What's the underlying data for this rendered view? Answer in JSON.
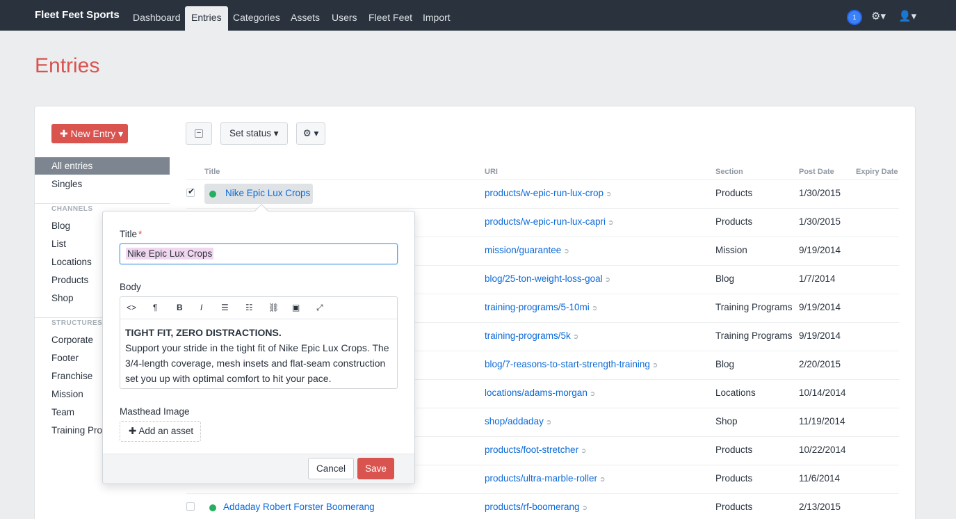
{
  "nav": {
    "brand": "Fleet Feet Sports",
    "items": [
      "Dashboard",
      "Entries",
      "Categories",
      "Assets",
      "Users",
      "Fleet Feet",
      "Import"
    ],
    "notification_count": "1"
  },
  "page": {
    "title": "Entries"
  },
  "sidebar": {
    "new_entry": "New Entry",
    "all_entries": "All entries",
    "singles": "Singles",
    "channels_heading": "CHANNELS",
    "channels": [
      "Blog",
      "List",
      "Locations",
      "Products",
      "Shop"
    ],
    "structures_heading": "STRUCTURES",
    "structures": [
      "Corporate",
      "Footer",
      "Franchise",
      "Mission",
      "Team",
      "Training Prog"
    ]
  },
  "toolbar": {
    "set_status": "Set status"
  },
  "table": {
    "headers": {
      "title": "Title",
      "uri": "URI",
      "section": "Section",
      "post_date": "Post Date",
      "expiry_date": "Expiry Date"
    },
    "rows": [
      {
        "title": "Nike Epic Lux Crops",
        "uri": "products/w-epic-run-lux-crop",
        "section": "Products",
        "date": "1/30/2015"
      },
      {
        "title": "",
        "uri": "products/w-epic-run-lux-capri",
        "section": "Products",
        "date": "1/30/2015"
      },
      {
        "title": "",
        "uri": "mission/guarantee",
        "section": "Mission",
        "date": "9/19/2014"
      },
      {
        "title": "",
        "uri": "blog/25-ton-weight-loss-goal",
        "section": "Blog",
        "date": "1/7/2014"
      },
      {
        "title": "",
        "uri": "training-programs/5-10mi",
        "section": "Training Programs",
        "date": "9/19/2014"
      },
      {
        "title": "",
        "uri": "training-programs/5k",
        "section": "Training Programs",
        "date": "9/19/2014"
      },
      {
        "title": "",
        "uri": "blog/7-reasons-to-start-strength-training",
        "section": "Blog",
        "date": "2/20/2015"
      },
      {
        "title": "",
        "uri": "locations/adams-morgan",
        "section": "Locations",
        "date": "10/14/2014"
      },
      {
        "title": "",
        "uri": "shop/addaday",
        "section": "Shop",
        "date": "11/19/2014"
      },
      {
        "title": "",
        "uri": "products/foot-stretcher",
        "section": "Products",
        "date": "10/22/2014"
      },
      {
        "title": "",
        "uri": "products/ultra-marble-roller",
        "section": "Products",
        "date": "11/6/2014"
      },
      {
        "title": "Addaday Robert Forster Boomerang",
        "uri": "products/rf-boomerang",
        "section": "Products",
        "date": "2/13/2015"
      }
    ]
  },
  "editor": {
    "title_label": "Title",
    "title_value": "Nike Epic Lux Crops",
    "body_label": "Body",
    "body_heading": "TIGHT FIT, ZERO DISTRACTIONS.",
    "body_text": "Support your stride in the tight fit of Nike Epic Lux Crops. The 3/4-length coverage, mesh insets and flat-seam construction set you up with optimal comfort to hit your pace.",
    "masthead_label": "Masthead Image",
    "add_asset": "Add an asset",
    "cancel": "Cancel",
    "save": "Save"
  }
}
